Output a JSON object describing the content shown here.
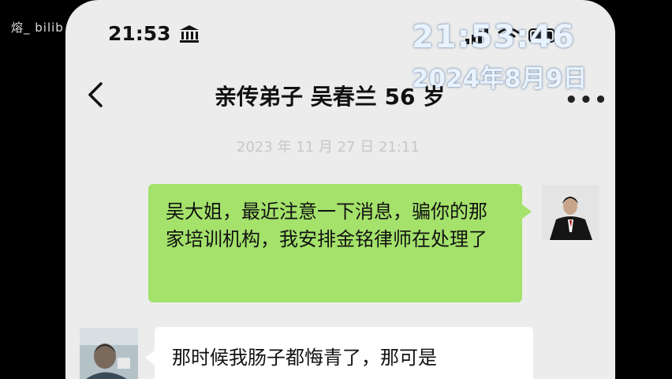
{
  "watermark": "熔_ bilib",
  "overlay": {
    "time": "21:53:46",
    "date": "2024年8月9日"
  },
  "status_bar": {
    "time": "21:53"
  },
  "header": {
    "title": "亲传弟子 吴春兰 56 岁"
  },
  "chat": {
    "timestamp": "2023 年 11 月 27 日 21:11",
    "messages": [
      {
        "from": "me",
        "text": "吴大姐，最近注意一下消息，骗你的那家培训机构，我安排金铭律师在处理了"
      },
      {
        "from": "other",
        "text": "那时候我肠子都悔青了，那可是"
      }
    ]
  },
  "icons": [
    "bank-icon",
    "signal-icon",
    "wifi-icon",
    "battery-icon",
    "back-arrow-icon",
    "more-icon"
  ],
  "colors": {
    "phone_bg": "#ececec",
    "outgoing_bubble": "#a4e26b",
    "incoming_bubble": "#ffffff"
  }
}
